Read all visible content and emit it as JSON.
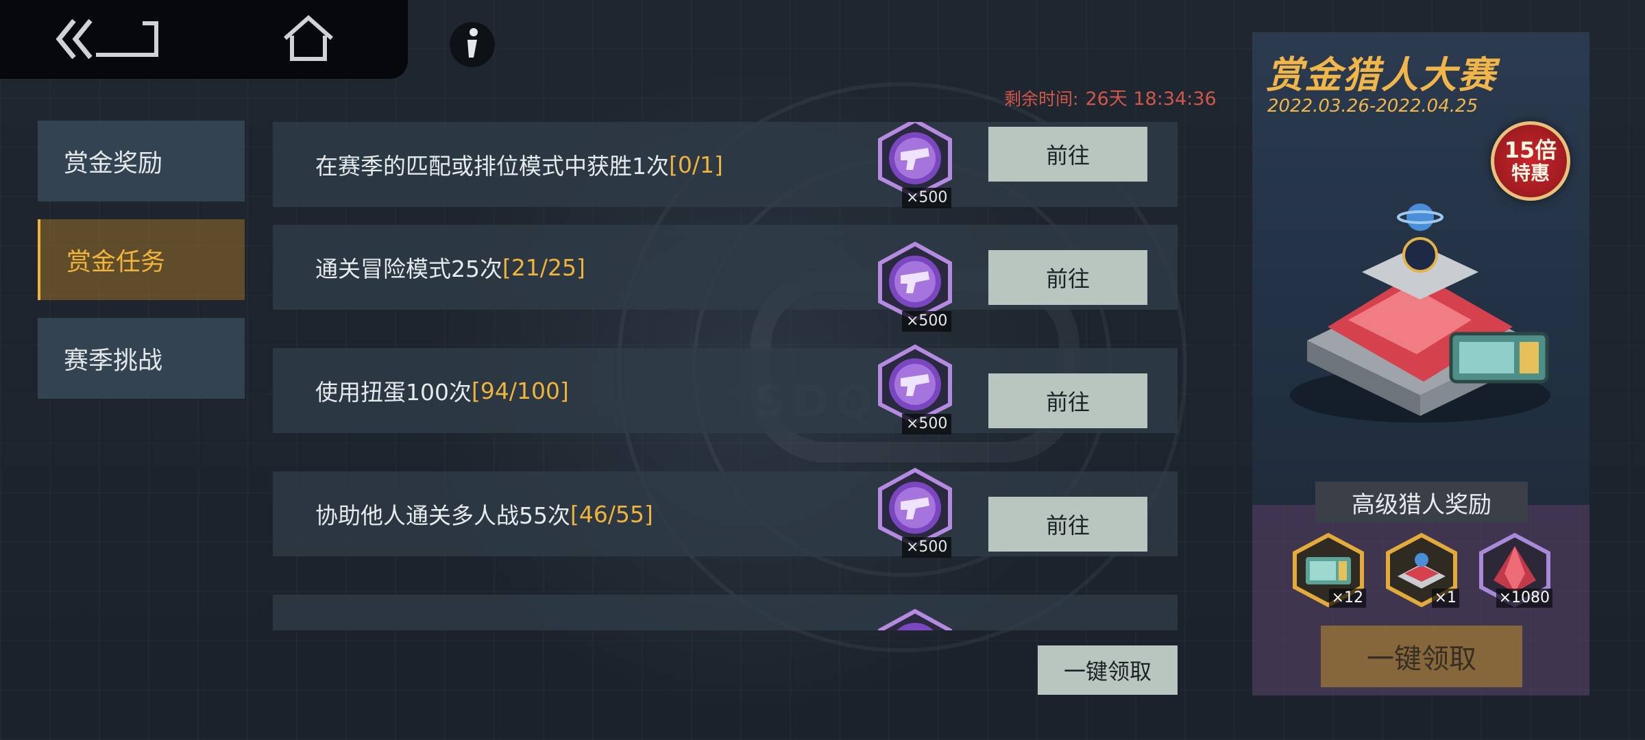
{
  "timer": {
    "label": "剩余时间:",
    "value": "26天 18:34:36"
  },
  "sidebar": {
    "items": [
      {
        "label": "赏金奖励",
        "active": false
      },
      {
        "label": "赏金任务",
        "active": true
      },
      {
        "label": "赛季挑战",
        "active": false
      }
    ]
  },
  "tasks": [
    {
      "text": "在赛季的匹配或排位模式中获胜1次",
      "progress": "[0/1]",
      "reward_qty": "×500",
      "button": "前往"
    },
    {
      "text": "通关冒险模式25次",
      "progress": "[21/25]",
      "reward_qty": "×500",
      "button": "前往"
    },
    {
      "text": "使用扭蛋100次",
      "progress": "[94/100]",
      "reward_qty": "×500",
      "button": "前往"
    },
    {
      "text": "协助他人通关多人战55次",
      "progress": "[46/55]",
      "reward_qty": "×500",
      "button": "前往"
    }
  ],
  "claim_all_label": "一键领取",
  "panel": {
    "title": "赏金猎人大赛",
    "date": "2022.03.26-2022.04.25",
    "badge_line1": "15倍",
    "badge_line2": "特惠",
    "subtitle": "高级猎人奖励",
    "rewards": [
      {
        "icon": "ticket-icon",
        "qty": "×12"
      },
      {
        "icon": "crate-icon",
        "qty": "×1"
      },
      {
        "icon": "crystal-icon",
        "qty": "×1080"
      }
    ],
    "claim_label": "一键领取"
  },
  "colors": {
    "accent": "#f0b43a",
    "timer": "#d2574a",
    "button": "#b9c6c0"
  }
}
